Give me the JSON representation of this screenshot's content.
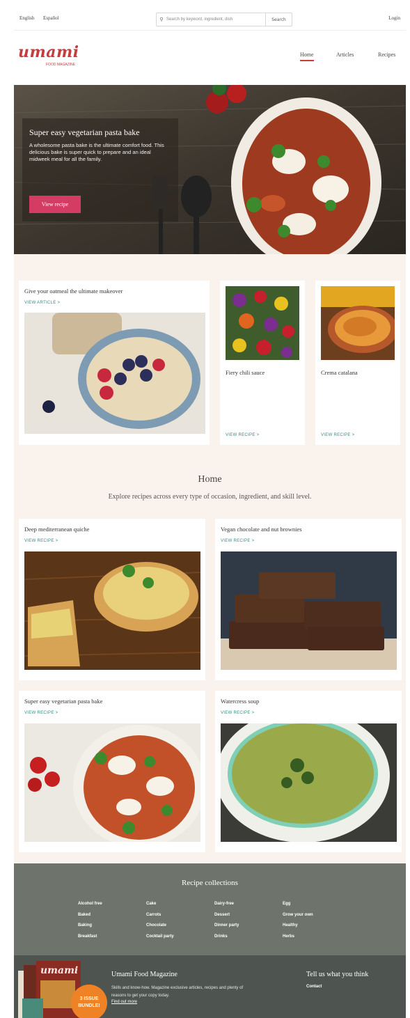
{
  "topbar": {
    "lang_en": "English",
    "lang_es": "Español",
    "search_placeholder": "Search by keyword, ingredient, dish",
    "search_button": "Search",
    "login": "Login"
  },
  "header": {
    "logo": "umami",
    "logo_sub": "FOOD MAGAZINE",
    "nav": [
      "Home",
      "Articles",
      "Recipes"
    ],
    "active_nav": "Home"
  },
  "hero": {
    "title": "Super easy vegetarian pasta bake",
    "description": "A wholesome pasta bake is the ultimate comfort food. This delicious bake is super quick to prepare and an ideal midweek meal for all the family.",
    "button": "View recipe"
  },
  "featured": [
    {
      "title": "Give your oatmeal the ultimate makeover",
      "link": "VIEW ARTICLE >"
    },
    {
      "title": "Fiery chili sauce",
      "link": "VIEW RECIPE >"
    },
    {
      "title": "Crema catalana",
      "link": "VIEW RECIPE >"
    }
  ],
  "home": {
    "heading": "Home",
    "subheading": "Explore recipes across every type of occasion, ingredient, and skill level."
  },
  "recipes": [
    {
      "title": "Deep mediterranean quiche",
      "link": "VIEW RECIPE >"
    },
    {
      "title": "Vegan chocolate and nut brownies",
      "link": "VIEW RECIPE >"
    },
    {
      "title": "Super easy vegetarian pasta bake",
      "link": "VIEW RECIPE >"
    },
    {
      "title": "Watercress soup",
      "link": "VIEW RECIPE >"
    }
  ],
  "collections": {
    "heading": "Recipe collections",
    "columns": [
      [
        "Alcohol free",
        "Baked",
        "Baking",
        "Breakfast"
      ],
      [
        "Cake",
        "Carrots",
        "Chocolate",
        "Cocktail party"
      ],
      [
        "Dairy-free",
        "Dessert",
        "Dinner party",
        "Drinks"
      ],
      [
        "Egg",
        "Grow your own",
        "Healthy",
        "Herbs"
      ]
    ]
  },
  "footer": {
    "magazine_title": "Umami Food Magazine",
    "magazine_desc": "Skills and know-how. Magazine exclusive articles, recipes and plenty of reasons to get your copy today.",
    "magazine_link": "Find out more",
    "badge_line1": "3 ISSUE",
    "badge_line2": "BUNDLE!",
    "cover_logo": "umami",
    "feedback_title": "Tell us what you think",
    "contact": "Contact"
  },
  "colors": {
    "brand": "#c53d3d",
    "cta": "#d43c63",
    "link": "#3a8a83",
    "cream": "#faf3ed",
    "collections_bg": "#6e736b",
    "footer_bg": "#4e5450",
    "badge": "#f08226"
  }
}
